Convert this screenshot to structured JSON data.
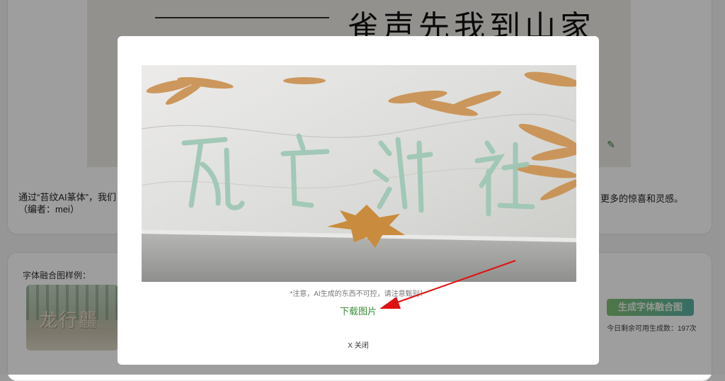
{
  "background": {
    "preview_title": "雀声先我到山家",
    "description_left_line1": "通过“苔纹AI篆体”，我们",
    "description_left_line2": "（编者：mei）",
    "description_right": "更多的惊喜和灵感。",
    "samples_label": "字体融合图样例：",
    "sample_glyphs": "龙行龘",
    "generate_button": "生成字体融合图",
    "quota_text": "今日剩余可用生成数：197次"
  },
  "modal": {
    "image_glyphs": [
      "死",
      "亡",
      "游",
      "社"
    ],
    "notice": "*注意，AI生成的东西不可控，请注意甄别！",
    "download_label": "下载图片",
    "close_label": "X 关闭"
  },
  "colors": {
    "accent_green": "#3a8f3a",
    "annotation_arrow": "#e01010"
  }
}
